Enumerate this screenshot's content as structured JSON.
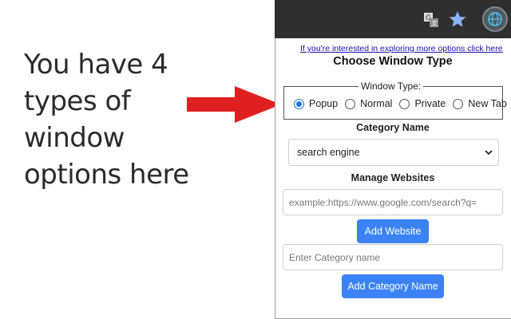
{
  "promo": {
    "line1": "You have 4",
    "line2": "types of",
    "line3": "window",
    "line4": "options here"
  },
  "colors": {
    "accent": "#3b82f6",
    "arrow": "#e02020",
    "radio_checked": "#1a73e8",
    "toolbar": "#2f2f2f"
  },
  "toolbar": {
    "icons": [
      "translate-icon",
      "star-icon",
      "extension-icon"
    ]
  },
  "popup": {
    "link_prefix": "If you're interested in exploring more options ",
    "link_cta": "click here",
    "title": "Choose Window Type",
    "window_type_legend": "Window Type:",
    "window_types": [
      {
        "label": "Popup",
        "checked": true
      },
      {
        "label": "Normal",
        "checked": false
      },
      {
        "label": "Private",
        "checked": false
      },
      {
        "label": "New Tab",
        "checked": false
      }
    ],
    "category_label": "Category Name",
    "category_selected": "search engine",
    "manage_label": "Manage Websites",
    "website_placeholder": "example:https://www.google.com/search?q=",
    "add_website_button": "Add Website",
    "category_placeholder": "Enter Category name",
    "add_category_button": "Add Category Name"
  }
}
